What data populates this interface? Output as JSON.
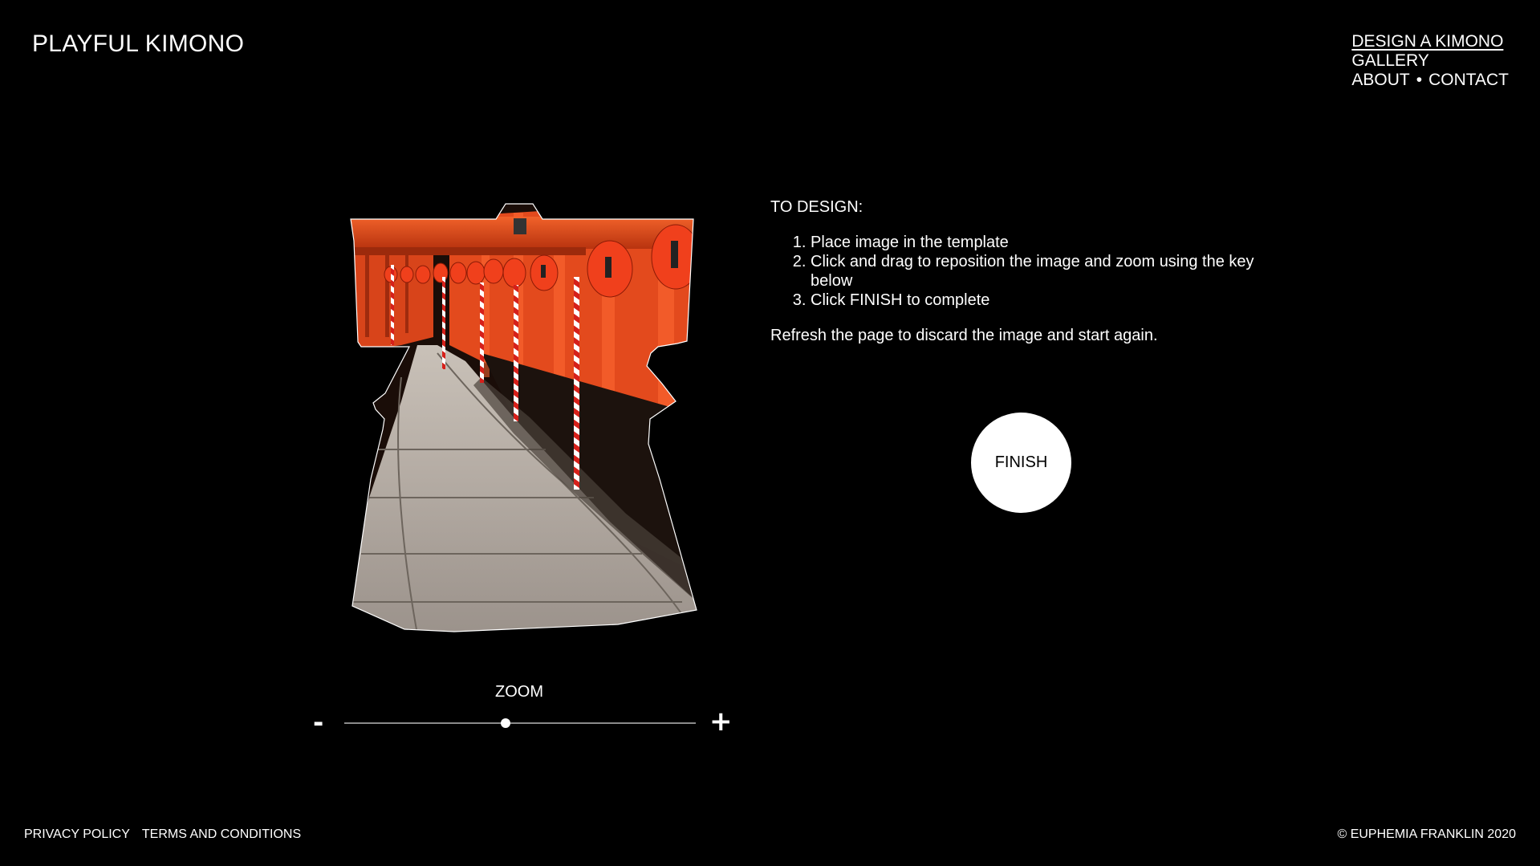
{
  "header": {
    "logo": "PLAYFUL KIMONO"
  },
  "nav": {
    "design": "DESIGN A KIMONO",
    "gallery": "GALLERY",
    "about": "ABOUT",
    "separator": "•",
    "contact": "CONTACT"
  },
  "editor": {
    "zoom_label": "ZOOM",
    "zoom_minus": "-",
    "zoom_plus": "+",
    "zoom_level": 0.46
  },
  "instructions": {
    "heading": "TO DESIGN:",
    "steps": [
      "Place image in the template",
      "Click and drag to reposition the image and zoom using the key below",
      "Click FINISH to complete"
    ],
    "note": "Refresh the page to discard the image and start again."
  },
  "finish_label": "FINISH",
  "footer": {
    "privacy": "PRIVACY POLICY",
    "terms": "TERMS AND CONDITIONS",
    "copyright": "© EUPHEMIA FRANKLIN 2020"
  },
  "colors": {
    "background": "#000000",
    "text": "#ffffff",
    "torii_orange": "#e8481a",
    "path_stone": "#a59d95"
  },
  "icons": [
    "minus-icon",
    "plus-icon"
  ]
}
